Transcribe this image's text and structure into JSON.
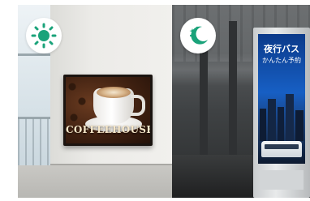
{
  "scenes": {
    "day": {
      "mode_icon": "sun-icon",
      "icon_color": "#1aa37a",
      "signage": {
        "label": "COFFEEHOUSE"
      }
    },
    "night": {
      "mode_icon": "moon-stars-icon",
      "icon_color": "#1aa37a",
      "signage": {
        "title": "夜行バス",
        "subtitle": "かんたん予約"
      }
    }
  }
}
